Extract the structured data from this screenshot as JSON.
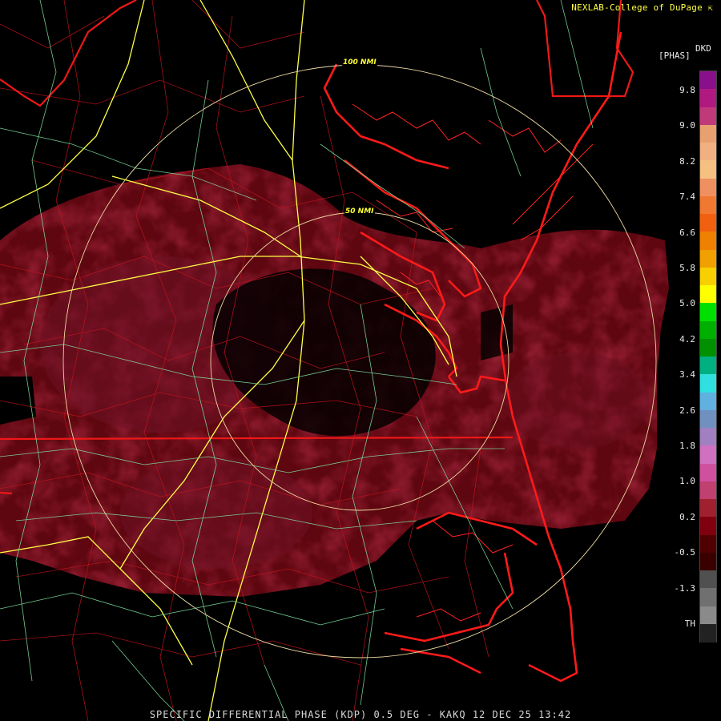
{
  "credit": {
    "text": "NEXLAB-College of DuPage",
    "mark": "⇱"
  },
  "legend": {
    "product": "DKD",
    "unit": "[PHAS]",
    "labels": [
      "9.8",
      "9.0",
      "8.2",
      "7.4",
      "6.6",
      "5.8",
      "5.0",
      "4.2",
      "3.4",
      "2.6",
      "1.8",
      "1.0",
      "0.2",
      "-0.5",
      "-1.3",
      "TH"
    ],
    "colors": [
      "#8a0f8a",
      "#b01a80",
      "#c03a7a",
      "#e8a070",
      "#f0b080",
      "#f5c080",
      "#f09060",
      "#f07830",
      "#f06010",
      "#f08000",
      "#f0a000",
      "#f8d000",
      "#ffff00",
      "#00e000",
      "#00b000",
      "#009000",
      "#00b080",
      "#30e0e0",
      "#60b0e0",
      "#7090c0",
      "#a080c0",
      "#d070c0",
      "#d050a0",
      "#c04070",
      "#a02030",
      "#800010",
      "#500000",
      "#3a0000",
      "#505050",
      "#707070",
      "#8a8a8a",
      "#222222"
    ]
  },
  "rings": [
    {
      "label": "100 NMI"
    },
    {
      "label": "50 NMI"
    }
  ],
  "footer": "SPECIFIC DIFFERENTIAL PHASE (KDP) 0.5 DEG - KAKQ 12 DEC 25 13:42"
}
